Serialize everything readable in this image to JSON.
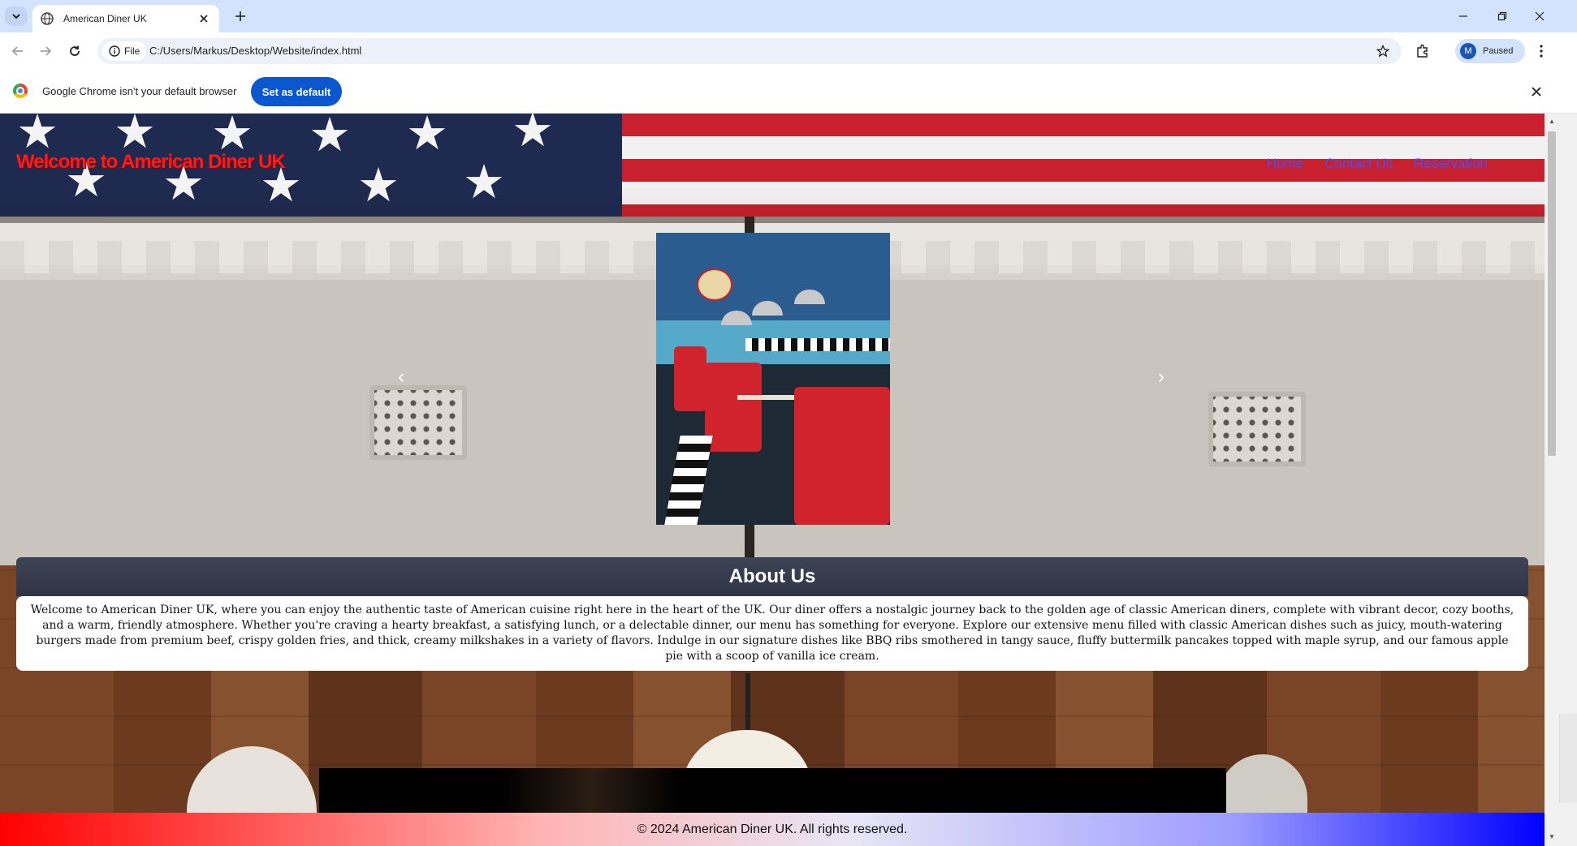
{
  "browser": {
    "tab": {
      "title": "American Diner UK"
    },
    "address": {
      "chip_label": "File",
      "url": "C:/Users/Markus/Desktop/Website/index.html"
    },
    "profile": {
      "initial": "M",
      "status": "Paused"
    },
    "infobar": {
      "message": "Google Chrome isn't your default browser",
      "button_label": "Set as default"
    },
    "icons": [
      "tab-list-icon",
      "globe-icon",
      "close-icon",
      "plus-icon",
      "minimize-icon",
      "restore-icon",
      "back-icon",
      "forward-icon",
      "reload-icon",
      "info-icon",
      "star-icon",
      "extensions-icon",
      "more-icon",
      "chrome-logo"
    ]
  },
  "site": {
    "title": "Welcome to American Diner UK",
    "nav": [
      {
        "label": "Home"
      },
      {
        "label": "Contact Us"
      },
      {
        "label": "Reservation"
      }
    ],
    "carousel": {
      "prev": "‹",
      "next": "›"
    },
    "about": {
      "heading": "About Us",
      "text": "Welcome to American Diner UK, where you can enjoy the authentic taste of American cuisine right here in the heart of the UK. Our diner offers a nostalgic journey back to the golden age of classic American diners, complete with vibrant decor, cozy booths, and a warm, friendly atmosphere. Whether you're craving a hearty breakfast, a satisfying lunch, or a delectable dinner, our menu has something for everyone. Explore our extensive menu filled with classic American dishes such as juicy, mouth-watering burgers made from premium beef, crispy golden fries, and thick, creamy milkshakes in a variety of flavors. Indulge in our signature dishes like BBQ ribs smothered in tangy sauce, fluffy buttermilk pancakes topped with maple syrup, and our famous apple pie with a scoop of vanilla ice cream."
    },
    "footer": "© 2024 American Diner UK. All rights reserved."
  },
  "colors": {
    "tabstrip": "#d3e3fd",
    "accent_button": "#0b57d0",
    "title_red": "#ff1a1a",
    "nav_link": "#4b4bff",
    "footer_left": "#ff0000",
    "footer_right": "#0000ff"
  }
}
